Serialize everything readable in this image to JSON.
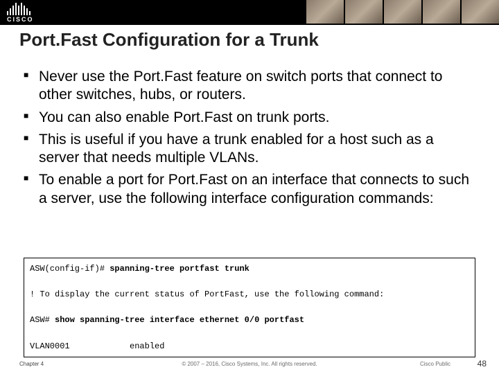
{
  "header": {
    "logo_text": "CISCO"
  },
  "title": "Port.Fast Configuration for a Trunk",
  "bullets": [
    "Never use the Port.Fast feature on switch ports that connect to other switches, hubs, or routers.",
    "You can also enable Port.Fast on trunk ports.",
    "This is useful if you have a trunk enabled for a host such as a server that needs multiple VLANs.",
    "To enable a port for Port.Fast on an interface that connects to such a server, use the following interface configuration commands:"
  ],
  "code": {
    "line1_prompt": "ASW(config-if)# ",
    "line1_cmd": "spanning-tree portfast trunk",
    "line2": "! To display the current status of PortFast, use the following command:",
    "line3_prompt": "ASW# ",
    "line3_cmd": "show spanning-tree interface ethernet 0/0 portfast",
    "line4": "VLAN0001            enabled"
  },
  "footer": {
    "chapter": "Chapter 4",
    "copyright": "© 2007 – 2016, Cisco Systems, Inc. All rights reserved.",
    "label": "Cisco Public",
    "page": "48"
  }
}
